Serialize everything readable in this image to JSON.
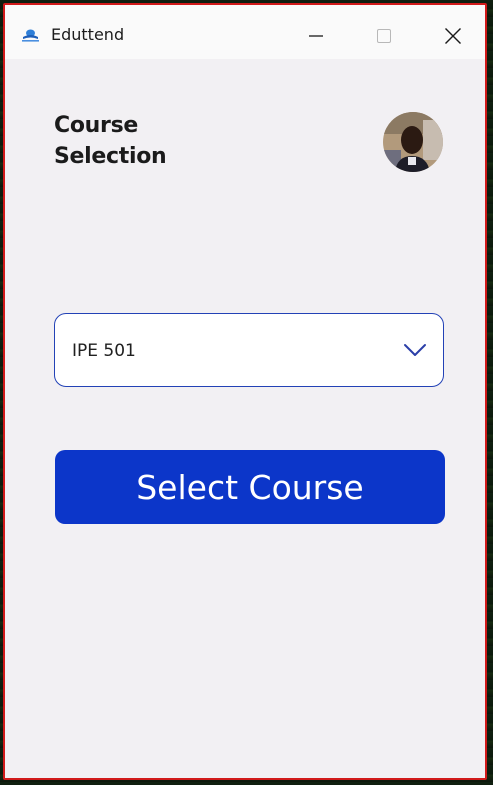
{
  "window": {
    "title": "Eduttend",
    "app_icon": "eduttend-logo-icon",
    "controls": {
      "minimize_icon": "minimize-icon",
      "maximize_icon": "maximize-icon",
      "close_icon": "close-icon"
    },
    "border_color": "#d11a1a"
  },
  "header": {
    "title": "Course Selection",
    "avatar": "user-avatar"
  },
  "course_select": {
    "value": "IPE 501",
    "icon": "chevron-down-icon",
    "border_color": "#2342b6"
  },
  "actions": {
    "select_label": "Select Course",
    "select_color": "#0c36c9"
  }
}
